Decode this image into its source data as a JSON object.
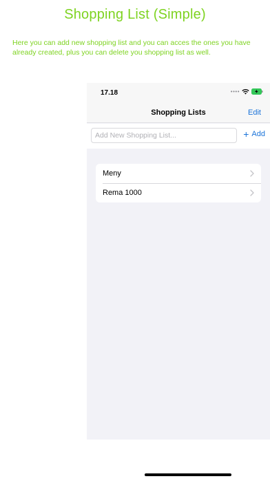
{
  "promo": {
    "title": "Shopping List (Simple)",
    "description": "Here you can add new shopping list and you can acces the ones you have already created, plus you can delete you shopping list as well."
  },
  "status_bar": {
    "time": "17.18",
    "icons": [
      "cellular-dots-icon",
      "wifi-icon",
      "battery-charging-icon"
    ]
  },
  "nav": {
    "title": "Shopping Lists",
    "edit_label": "Edit"
  },
  "add_row": {
    "placeholder": "Add New Shopping List...",
    "add_label": "Add"
  },
  "lists": [
    {
      "label": "Meny"
    },
    {
      "label": "Rema 1000"
    }
  ],
  "colors": {
    "promo_green": "#7ed321",
    "accent_blue": "#1a73d9",
    "background_gray": "#f2f2f7"
  }
}
